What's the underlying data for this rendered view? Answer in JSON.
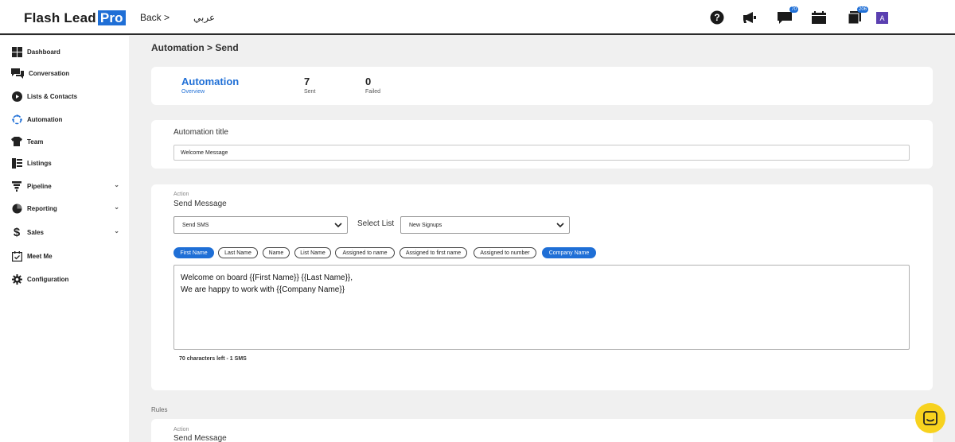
{
  "header": {
    "logo_text": "Flash Lead",
    "logo_pro": "Pro",
    "back_label": "Back  >",
    "language_label": "عربي",
    "icons": [
      "help-icon",
      "megaphone-icon",
      "chat-icon",
      "calendar-icon",
      "inbox-icon"
    ],
    "chat_badge": "70",
    "inbox_badge": "206",
    "avatar_initial": "A",
    "accent_color": "#1f6fd6"
  },
  "sidebar": {
    "items": [
      {
        "label": "Dashboard",
        "icon": "dashboard-icon"
      },
      {
        "label": "Conversation",
        "icon": "conversation-icon"
      },
      {
        "label": "Lists & Contacts",
        "icon": "lists-icon"
      },
      {
        "label": "Automation",
        "icon": "automation-icon"
      },
      {
        "label": "Team",
        "icon": "team-icon"
      },
      {
        "label": "Listings",
        "icon": "listings-icon"
      },
      {
        "label": "Pipeline",
        "icon": "pipeline-icon",
        "has_submenu": true
      },
      {
        "label": "Reporting",
        "icon": "reporting-icon",
        "has_submenu": true
      },
      {
        "label": "Sales",
        "icon": "dollar-icon",
        "has_submenu": true
      },
      {
        "label": "Meet Me",
        "icon": "calendar-check-icon"
      },
      {
        "label": "Configuration",
        "icon": "gear-icon"
      }
    ],
    "chevron": "⌄"
  },
  "breadcrumb": "Automation > Send",
  "overview": {
    "title": "Automation",
    "subtitle": "Overview",
    "sent_value": "7",
    "sent_label": "Sent",
    "failed_value": "0",
    "failed_label": "Failed"
  },
  "title_card": {
    "label": "Automation title",
    "value": "Welcome Message"
  },
  "action_card": {
    "small_label": "Action",
    "heading": "Send Message",
    "action_select_value": "Send SMS",
    "list_label": "Select List",
    "list_select_value": "New Signups",
    "chips": [
      {
        "label": "First Name",
        "active": true
      },
      {
        "label": "Last Name",
        "active": false
      },
      {
        "label": "Name",
        "active": false
      },
      {
        "label": "List Name",
        "active": false
      },
      {
        "label": "Assigned to name",
        "active": false
      },
      {
        "label": "Assigned to first name",
        "active": false
      },
      {
        "label": "Assigned to number",
        "active": false
      },
      {
        "label": "Company Name",
        "active": true
      }
    ],
    "message_line1": "Welcome on board {{First Name}} {{Last Name}},",
    "message_line2": "We are happy to work with {{Company Name}}",
    "counter": "70 characters left - 1 SMS"
  },
  "rules": {
    "label": "Rules",
    "small_label": "Action",
    "heading": "Send Message"
  }
}
